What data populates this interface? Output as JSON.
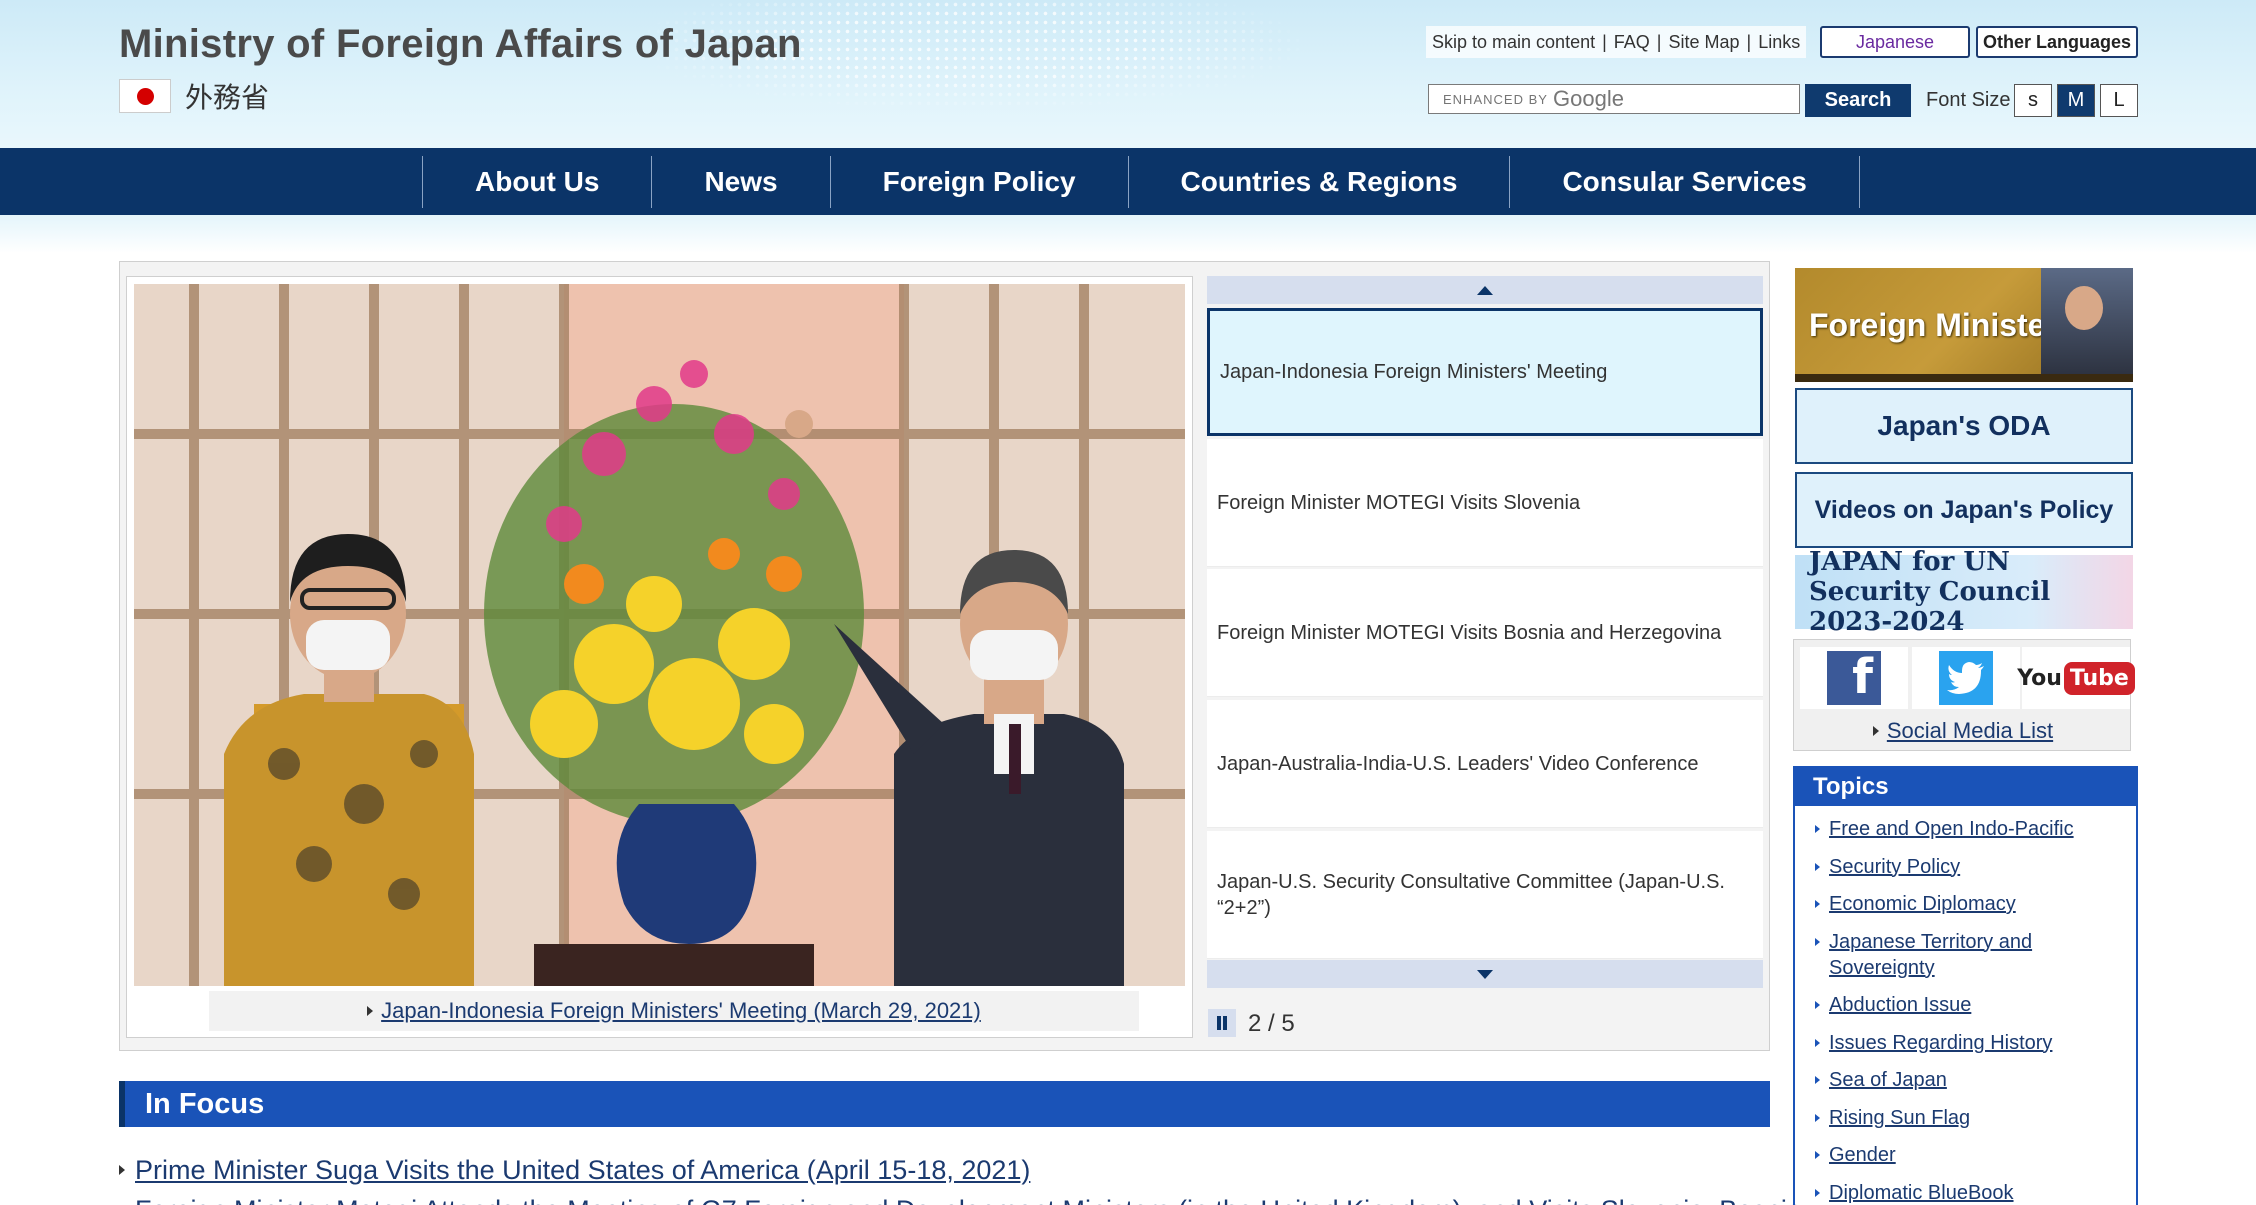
{
  "header": {
    "site_title": "Ministry of Foreign Affairs of Japan",
    "site_subtitle": "外務省",
    "util_links": [
      "Skip to main content",
      "FAQ",
      "Site Map",
      "Links"
    ],
    "lang_japanese": "Japanese",
    "lang_other": "Other Languages",
    "search_placeholder": "ENHANCED BY",
    "search_google_word": "Google",
    "search_button": "Search",
    "font_size_label": "Font Size",
    "font_sizes": [
      "S",
      "M",
      "L"
    ]
  },
  "nav": {
    "items": [
      "About Us",
      "News",
      "Foreign Policy",
      "Countries & Regions",
      "Consular Services"
    ]
  },
  "slider": {
    "caption": "Japan-Indonesia Foreign Ministers' Meeting (March 29, 2021)",
    "items": [
      "Japan-Indonesia Foreign Ministers' Meeting",
      "Foreign Minister MOTEGI Visits Slovenia",
      "Foreign Minister MOTEGI Visits Bosnia and Herzegovina",
      "Japan-Australia-India-U.S. Leaders' Video Conference",
      "Japan-U.S. Security Consultative Committee (Japan-U.S. “2+2”)"
    ],
    "active_index": 0,
    "counter": "2 / 5"
  },
  "in_focus": {
    "title": "In Focus",
    "items": [
      "Prime Minister Suga Visits the United States of America (April 15-18, 2021)",
      "Foreign Minister Motegi Attends the Meeting of G7 Foreign and Development Ministers (in the United Kingdom), and Visits Slovenia, Bosnia"
    ]
  },
  "sidebar": {
    "banner_minister": "Foreign Minister",
    "banner_oda": "Japan's ODA",
    "banner_videos": "Videos on Japan's Policy",
    "banner_un_line1": "JAPAN for UN",
    "banner_un_line2": "Security Council 2023-2024",
    "social_link": "Social Media List",
    "topics_title": "Topics",
    "topics": [
      "Free and Open Indo-Pacific",
      "Security Policy",
      "Economic Diplomacy",
      "Japanese Territory and Sovereignty",
      "Abduction Issue",
      "Issues Regarding History",
      "Sea of Japan",
      "Rising Sun Flag",
      "Gender",
      "Diplomatic BlueBook"
    ]
  },
  "colors": {
    "nav_bg": "#0b3468",
    "accent_blue": "#1a53b8",
    "link": "#1b3a70"
  }
}
